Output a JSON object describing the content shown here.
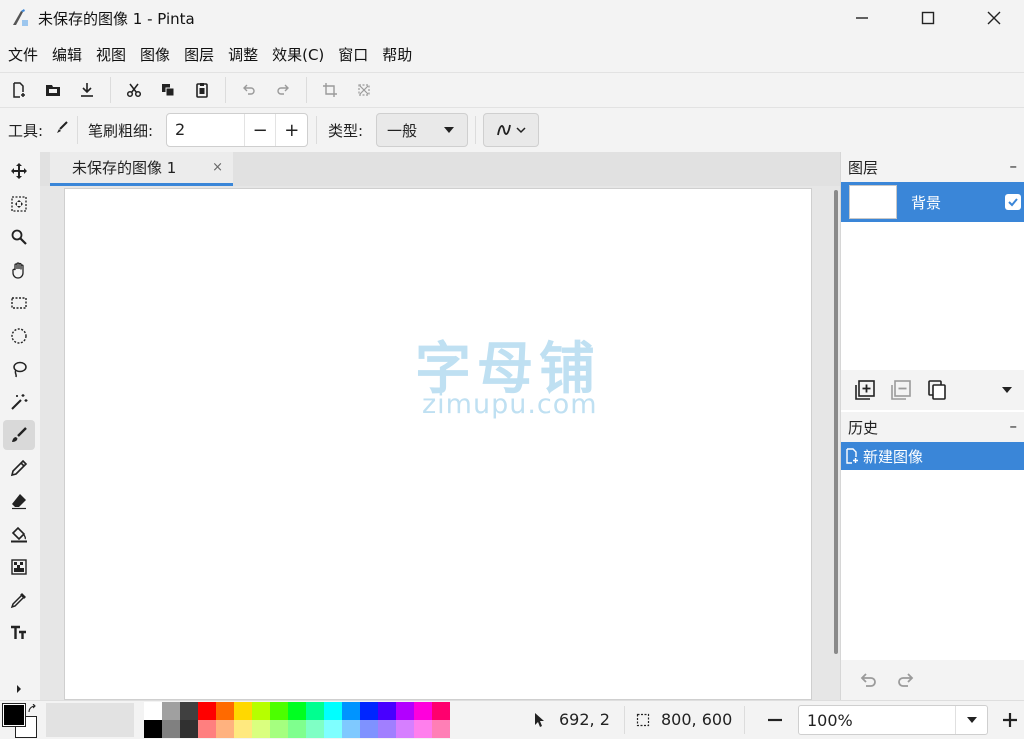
{
  "window": {
    "title": "未保存的图像 1 - Pinta"
  },
  "menu": [
    "文件",
    "编辑",
    "视图",
    "图像",
    "图层",
    "调整",
    "效果(C)",
    "窗口",
    "帮助"
  ],
  "options": {
    "tool_label": "工具:",
    "brush_width_label": "笔刷粗细:",
    "brush_width_value": "2",
    "minus": "−",
    "plus": "+",
    "type_label": "类型:",
    "type_value": "一般"
  },
  "document": {
    "tab_title": "未保存的图像 1",
    "tab_close": "×",
    "watermark_cn": "字母铺",
    "watermark_en": "zimupu.com"
  },
  "layers": {
    "title": "图层",
    "minimize": "–",
    "items": [
      {
        "name": "背景",
        "visible": true
      }
    ]
  },
  "history": {
    "title": "历史",
    "minimize": "–",
    "items": [
      "新建图像"
    ]
  },
  "status": {
    "cursor_pos": "692, 2",
    "selection_size": "800, 600",
    "zoom": "100%"
  },
  "palette": {
    "top": [
      "#ffffff",
      "#a0a0a0",
      "#404040",
      "#ff0000",
      "#ff6a00",
      "#ffd800",
      "#b6ff00",
      "#4cff00",
      "#00ff21",
      "#00ff90",
      "#00ffff",
      "#0094ff",
      "#0026ff",
      "#4800ff",
      "#b200ff",
      "#ff00dc",
      "#ff006e"
    ],
    "bottom": [
      "#000000",
      "#808080",
      "#303030",
      "#ff7f7f",
      "#ffb27f",
      "#ffe97f",
      "#daff7f",
      "#a5ff7f",
      "#7fff8e",
      "#7fffc5",
      "#7fffff",
      "#7fc9ff",
      "#7f92ff",
      "#a17fff",
      "#d67fff",
      "#ff7fed",
      "#ff7fb6"
    ]
  },
  "colors": {
    "accent": "#3a86d8",
    "primary": "#000000",
    "secondary": "#ffffff"
  }
}
